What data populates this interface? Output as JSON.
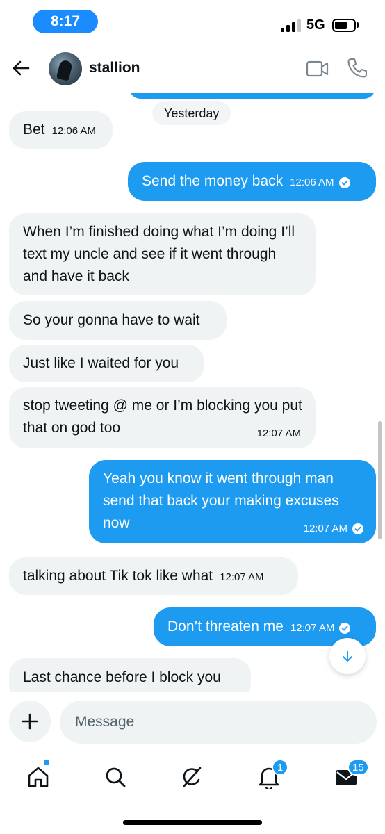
{
  "status_bar": {
    "time": "8:17",
    "network": "5G"
  },
  "header": {
    "contact_name": "stallion",
    "back_icon": "back-arrow-icon",
    "video_icon": "video-camera-icon",
    "phone_icon": "phone-icon"
  },
  "chat": {
    "date_divider": "Yesterday",
    "messages": [
      {
        "direction": "incoming",
        "text": "Bet",
        "time": "12:06 AM"
      },
      {
        "direction": "outgoing",
        "text": "Send the money back",
        "time": "12:06 AM",
        "read": true
      },
      {
        "direction": "incoming",
        "text": "When I’m finished doing what I’m doing I’ll text my uncle and see if it went through and have it back"
      },
      {
        "direction": "incoming",
        "text": "So your gonna have to wait"
      },
      {
        "direction": "incoming",
        "text": "Just like I waited for you"
      },
      {
        "direction": "incoming",
        "text": "stop tweeting @ me or I’m blocking you put that on god too",
        "time": "12:07 AM"
      },
      {
        "direction": "outgoing",
        "text": "Yeah you know it went through man send that back your making excuses now",
        "time": "12:07 AM",
        "read": true
      },
      {
        "direction": "incoming",
        "text": "talking about Tik tok like what",
        "time": "12:07 AM"
      },
      {
        "direction": "outgoing",
        "text": "Don’t threaten me",
        "time": "12:07 AM",
        "read": true
      },
      {
        "direction": "incoming",
        "text": "Last chance before I block you"
      }
    ]
  },
  "composer": {
    "placeholder": "Message",
    "add_icon": "plus-icon"
  },
  "bottom_nav": {
    "items": [
      {
        "name": "home",
        "icon": "home-icon",
        "has_dot": true
      },
      {
        "name": "search",
        "icon": "search-icon"
      },
      {
        "name": "grok",
        "icon": "grok-icon"
      },
      {
        "name": "notifications",
        "icon": "bell-icon",
        "badge": "1"
      },
      {
        "name": "messages",
        "icon": "envelope-icon",
        "badge": "15"
      }
    ]
  },
  "colors": {
    "accent": "#1d9bf0",
    "incoming_bubble": "#eff3f4",
    "text": "#0f1419",
    "placeholder": "#536471",
    "time_pill": "#1a8cff"
  }
}
